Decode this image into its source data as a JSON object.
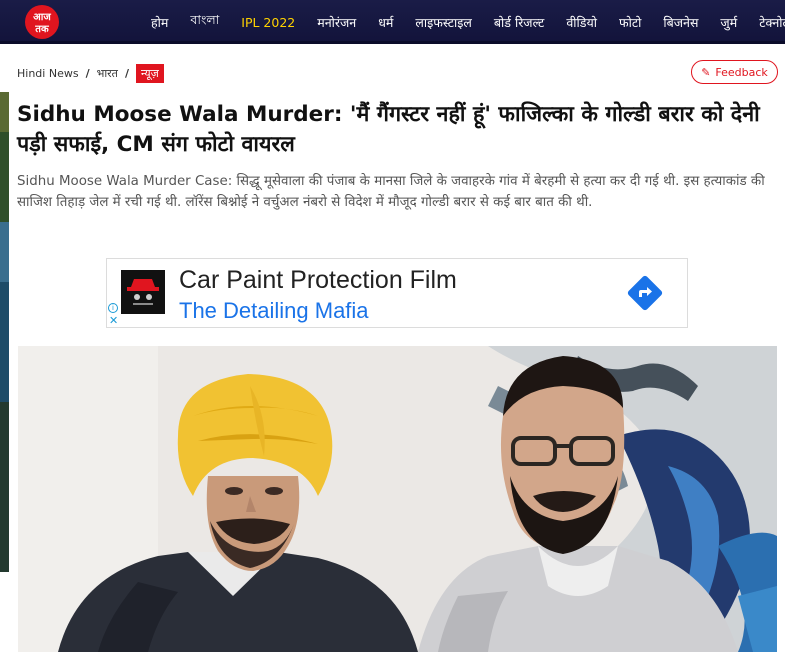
{
  "logo": {
    "text": "आज तक",
    "accent": "#e0151f"
  },
  "nav": {
    "items": [
      {
        "label": "होम"
      },
      {
        "label": "বাংলা"
      },
      {
        "label": "IPL 2022",
        "highlight": "#ffd200"
      },
      {
        "label": "मनोरंजन"
      },
      {
        "label": "धर्म"
      },
      {
        "label": "लाइफस्टाइल"
      },
      {
        "label": "बोर्ड रिजल्ट"
      },
      {
        "label": "वीडियो"
      },
      {
        "label": "फोटो"
      },
      {
        "label": "बिजनेस"
      },
      {
        "label": "जुर्म"
      },
      {
        "label": "टेक्नोलॉजी"
      }
    ]
  },
  "breadcrumb": {
    "items": [
      "Hindi News",
      "भारत"
    ],
    "tag": "न्यूज़"
  },
  "feedback": {
    "label": "Feedback",
    "icon": "pencil-icon"
  },
  "article": {
    "headline": "Sidhu Moose Wala Murder: 'मैं गैंगस्टर नहीं हूं' फाजिल्का के गोल्डी बरार को देनी पड़ी सफाई, CM संग फोटो वायरल",
    "summary": "Sidhu Moose Wala Murder Case: सिद्धू मूसेवाला की पंजाब के मानसा जिले के जवाहरके गांव में बेरहमी से हत्या कर दी गई थी. इस हत्याकांड की साजिश तिहाड़ जेल में रची गई थी. लॉरेंस बिश्नोई ने वर्चुअल नंबरो से विदेश में मौजूद गोल्डी बरार से कई बार बात की थी."
  },
  "ad": {
    "title": "Car Paint Protection Film",
    "subtitle": "The Detailing Mafia",
    "arrow_icon": "directions-arrow-icon",
    "info_icon": "ad-info-icon",
    "close_icon": "close-icon",
    "accent": "#1a73e8"
  },
  "photo": {
    "subject": "news-photo"
  }
}
